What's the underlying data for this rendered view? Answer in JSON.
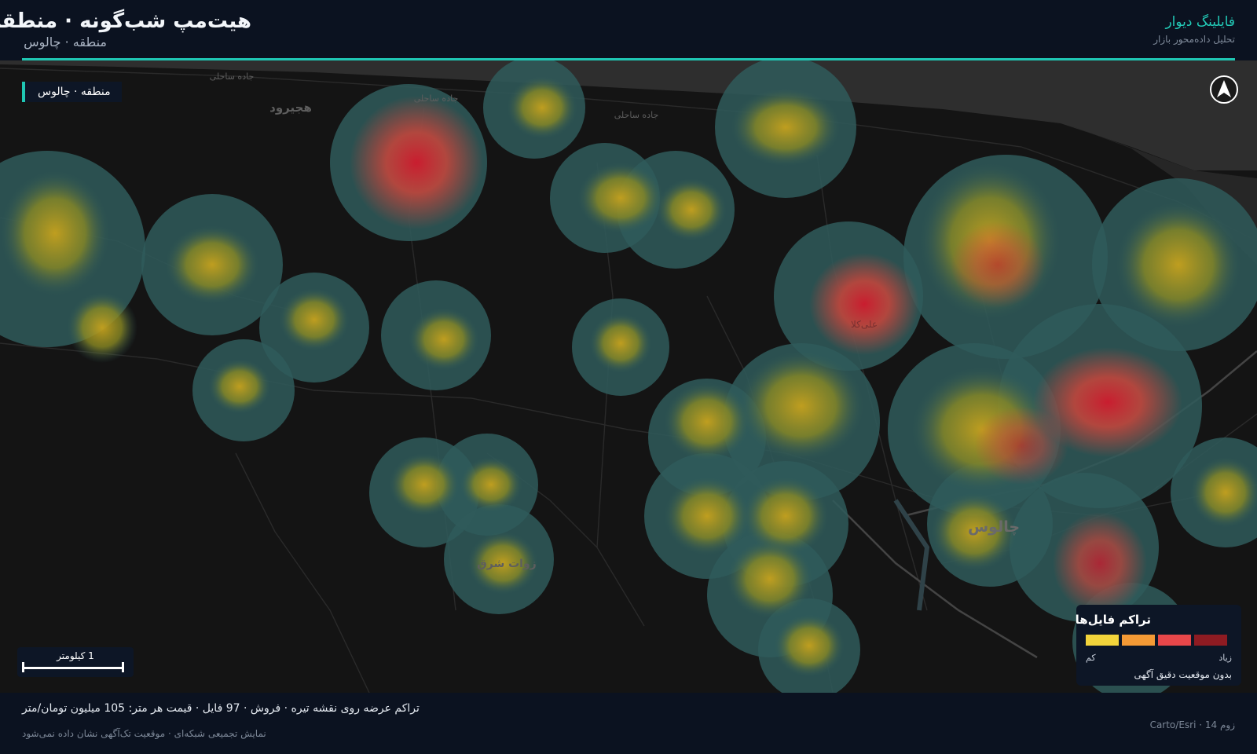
{
  "header": {
    "title": "هیت‌مپ شب‌گونه · منطقه",
    "subtitle": "منطقه · چالوس",
    "brand_name": "فایلینگ دیوار",
    "brand_tagline": "تحلیل داده‌محور بازار"
  },
  "map": {
    "area_chip": "منطقه · چالوس",
    "north_icon": "north-arrow-icon",
    "place_labels": {
      "hajirud": "هجیرود",
      "chalus": "چالوس",
      "zavat": "زوات شرق",
      "alikola": "علی‌کلا"
    },
    "road_labels": {
      "coastal": "جاده ساحلی"
    },
    "scale_label": "1 کیلومتر",
    "colors": {
      "land": "#141414",
      "sea": "#2e2e2e",
      "roads": "#2a2a2a",
      "accent": "#1fc7b4"
    }
  },
  "legend": {
    "title": "تراکم فایل‌ها",
    "low_label": "کم",
    "high_label": "زیاد",
    "note": "بدون موقعیت دقیق آگهی",
    "colors": [
      "#f2d43b",
      "#f49a35",
      "#e8474a",
      "#8e1b22"
    ]
  },
  "footer": {
    "summary": "تراکم عرضه روی نقشه تیره · فروش · 97 فایل · قیمت هر متر: 105 میلیون تومان/متر",
    "note": "نمایش تجمیعی شبکه‌ای · موقعیت تک‌آگهی نشان داده نمی‌شود",
    "attribution": "زوم 14 · Carto/Esri"
  }
}
